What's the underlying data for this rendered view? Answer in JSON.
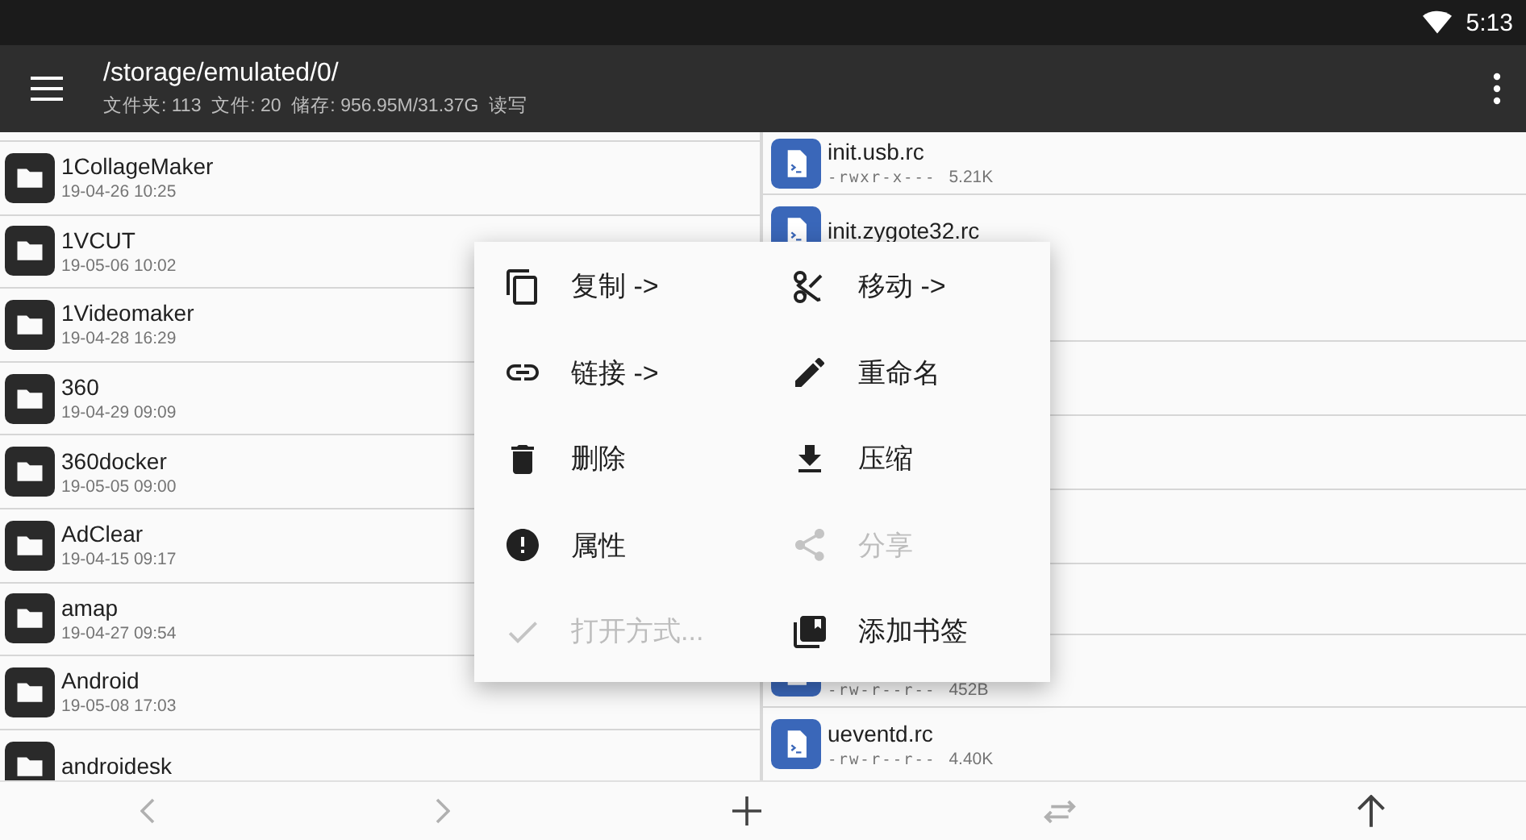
{
  "status_bar": {
    "time": "5:13"
  },
  "toolbar": {
    "title": "/storage/emulated/0/",
    "subtitle": "文件夹: 113  文件: 20  储存: 956.95M/31.37G  读写"
  },
  "left_pane": {
    "folders": [
      {
        "name": "1CollageMaker",
        "date": "19-04-26 10:25"
      },
      {
        "name": "1VCUT",
        "date": "19-05-06 10:02"
      },
      {
        "name": "1Videomaker",
        "date": "19-04-28 16:29"
      },
      {
        "name": "360",
        "date": "19-04-29 09:09"
      },
      {
        "name": "360docker",
        "date": "19-05-05 09:00"
      },
      {
        "name": "AdClear",
        "date": "19-04-15 09:17"
      },
      {
        "name": "amap",
        "date": "19-04-27 09:54"
      },
      {
        "name": "Android",
        "date": "19-05-08 17:03"
      },
      {
        "name": "androidesk"
      }
    ]
  },
  "right_pane": {
    "top_files": [
      {
        "name": "init.usb.rc",
        "perms": "-rwxr-x---",
        "size": "5.21K"
      },
      {
        "name": "init.zygote32.rc"
      }
    ],
    "bottom_files": [
      {
        "perms": "-rw-r--r--",
        "size": "452B"
      },
      {
        "name": "ueventd.rc",
        "perms": "-rw-r--r--",
        "size": "4.40K"
      }
    ]
  },
  "context_menu": {
    "items": [
      {
        "label": "复制 ->",
        "disabled": false
      },
      {
        "label": "移动 ->",
        "disabled": false
      },
      {
        "label": "链接 ->",
        "disabled": false
      },
      {
        "label": "重命名",
        "disabled": false
      },
      {
        "label": "删除",
        "disabled": false
      },
      {
        "label": "压缩",
        "disabled": false
      },
      {
        "label": "属性",
        "disabled": false
      },
      {
        "label": "分享",
        "disabled": true
      },
      {
        "label": "打开方式...",
        "disabled": true
      },
      {
        "label": "添加书签",
        "disabled": false
      }
    ]
  },
  "bottom_bar": {
    "buttons": [
      {
        "disabled": true
      },
      {
        "disabled": true
      },
      {
        "disabled": false
      },
      {
        "disabled": true
      },
      {
        "disabled": false
      }
    ]
  }
}
